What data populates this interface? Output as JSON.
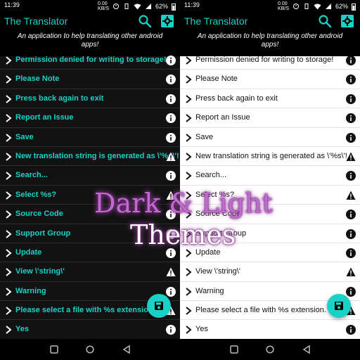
{
  "colors": {
    "accent": "#18d2c7",
    "dark_bg": "#121212",
    "light_bg": "#ffffff"
  },
  "status_bar": {
    "time": "11:39",
    "speed_value": "0.00",
    "speed_unit": "KB/S",
    "battery": "62%"
  },
  "app_bar": {
    "title": "The Translator",
    "subtitle": "An application to help translating other android apps!"
  },
  "rows": [
    {
      "label": "Permission denied for writing to storage!",
      "badge": "info"
    },
    {
      "label": "Please Note",
      "badge": "info"
    },
    {
      "label": "Press back again to exit",
      "badge": "info"
    },
    {
      "label": "Report an Issue",
      "badge": "info"
    },
    {
      "label": "Save",
      "badge": "info"
    },
    {
      "label": "New translation string is generated as \\'%s\\'!",
      "badge": "warning"
    },
    {
      "label": "Search...",
      "badge": "info"
    },
    {
      "label": "Select %s?",
      "badge": "warning"
    },
    {
      "label": "Source Code",
      "badge": "info"
    },
    {
      "label": "Support Group",
      "badge": "info"
    },
    {
      "label": "Update",
      "badge": "info"
    },
    {
      "label": "View \\'string\\'",
      "badge": "warning"
    },
    {
      "label": "Warning",
      "badge": "info"
    },
    {
      "label": "Please select a file with %s extension.",
      "badge": "warning"
    },
    {
      "label": "Yes",
      "badge": "info"
    }
  ],
  "overlay": {
    "line1_a": "Dark ",
    "line1_b": "& ",
    "line1_c": "Light",
    "line2": "Themes"
  },
  "icons": {
    "search": "search-icon",
    "settings": "gear-icon",
    "row_chevron": "chevron-right-icon",
    "info": "info-icon",
    "warning": "warning-icon",
    "save": "save-icon",
    "nav_recent": "square-icon",
    "nav_home": "circle-icon",
    "nav_back": "back-triangle-icon"
  }
}
